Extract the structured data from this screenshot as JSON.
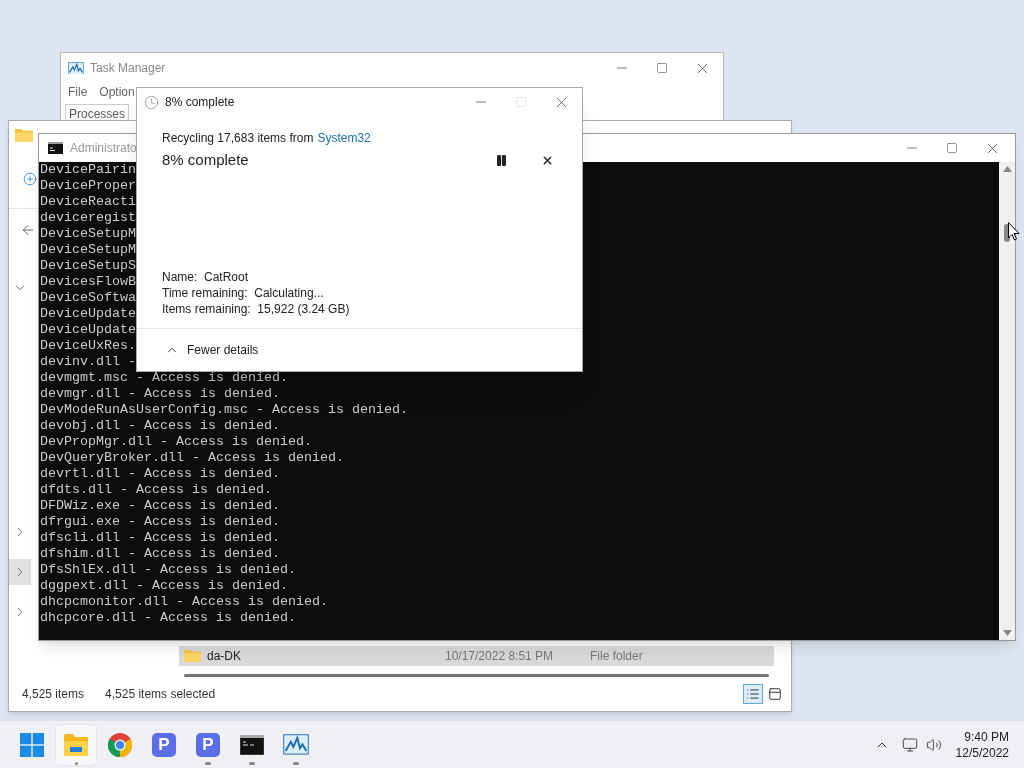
{
  "task_manager": {
    "title": "Task Manager",
    "menu": [
      "File",
      "Option"
    ],
    "tabs": [
      {
        "label": "Processes",
        "selected": true
      }
    ]
  },
  "explorer": {
    "nav_items": [
      {
        "expanded": true,
        "selected": false
      },
      {
        "expanded": false,
        "selected": false
      },
      {
        "expanded": false,
        "selected": true
      },
      {
        "expanded": false,
        "selected": false
      }
    ],
    "row": {
      "name": "da-DK",
      "modified": "10/17/2022 8:51 PM",
      "type": "File folder",
      "selected": true
    },
    "status_bar": {
      "count": "4,525 items",
      "selection": "4,525 items selected"
    },
    "views": [
      {
        "kind": "details",
        "selected": true
      },
      {
        "kind": "tiles",
        "selected": false
      }
    ]
  },
  "console": {
    "title": "Administrato",
    "lines": [
      "DevicePairin",
      "DeviceProper",
      "DeviceReacti",
      "deviceregist",
      "DeviceSetupM",
      "DeviceSetupM",
      "DeviceSetupS",
      "DevicesFlowB",
      "DeviceSoftwa",
      "DeviceUpdate",
      "DeviceUpdate",
      "DeviceUxRes.",
      "devinv.dll -",
      "devmgmt.msc - Access is denied.",
      "devmgr.dll - Access is denied.",
      "DevModeRunAsUserConfig.msc - Access is denied.",
      "devobj.dll - Access is denied.",
      "DevPropMgr.dll - Access is denied.",
      "DevQueryBroker.dll - Access is denied.",
      "devrtl.dll - Access is denied.",
      "dfdts.dll - Access is denied.",
      "DFDWiz.exe - Access is denied.",
      "dfrgui.exe - Access is denied.",
      "dfscli.dll - Access is denied.",
      "dfshim.dll - Access is denied.",
      "DfsShlEx.dll - Access is denied.",
      "dggpext.dll - Access is denied.",
      "dhcpcmonitor.dll - Access is denied.",
      "dhcpcore.dll - Access is denied."
    ]
  },
  "dialog": {
    "title": "8% complete",
    "maximize_disabled": true,
    "summary": "Recycling 17,683 items from",
    "source": "System32",
    "heading": "8% complete",
    "details": [
      {
        "label": "Name:",
        "value": "CatRoot"
      },
      {
        "label": "Time remaining:",
        "value": "Calculating..."
      },
      {
        "label": "Items remaining:",
        "value": "15,922 (3.24 GB)"
      }
    ],
    "toggle": "Fewer details"
  },
  "taskbar": {
    "apps": [
      {
        "kind": "start",
        "running": false,
        "active": false
      },
      {
        "kind": "explorer",
        "running": true,
        "active": true
      },
      {
        "kind": "chrome",
        "running": false,
        "active": false
      },
      {
        "kind": "p-app",
        "glyph": "P",
        "running": false,
        "active": false
      },
      {
        "kind": "p-app",
        "glyph": "P",
        "running": true,
        "active": false
      },
      {
        "kind": "terminal",
        "running": true,
        "active": false
      },
      {
        "kind": "task-manager",
        "running": true,
        "active": false
      }
    ],
    "time": "9:40 PM",
    "date": "12/5/2022"
  }
}
